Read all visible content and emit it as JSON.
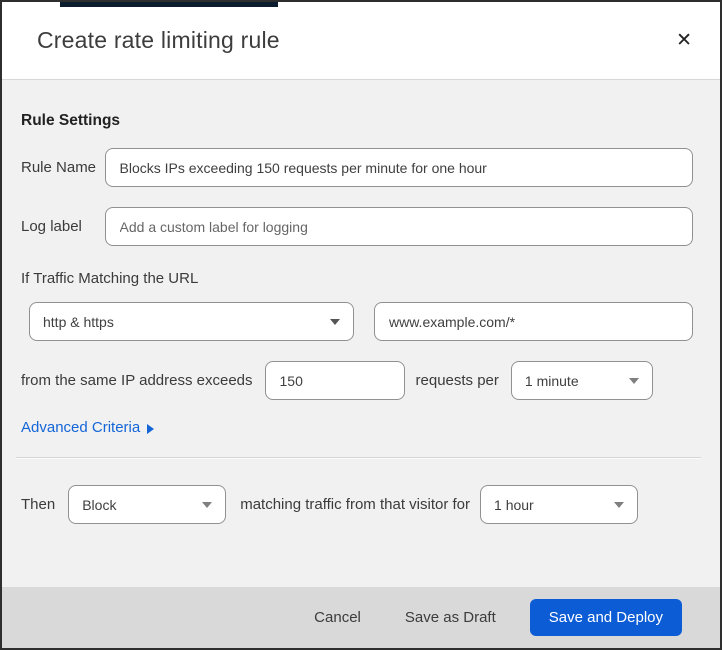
{
  "dialog": {
    "title": "Create rate limiting rule",
    "close_icon": "✕"
  },
  "rule_settings": {
    "section_heading": "Rule Settings",
    "rule_name": {
      "label": "Rule Name",
      "value": "Blocks IPs exceeding 150 requests per minute for one hour"
    },
    "log_label": {
      "label": "Log label",
      "placeholder": "Add a custom label for logging"
    }
  },
  "traffic_match": {
    "heading": "If Traffic Matching the URL",
    "scheme_select": {
      "selected": "http & https"
    },
    "url_input": {
      "value": "www.example.com/*"
    },
    "threshold": {
      "prefix": "from the same IP address exceeds",
      "requests_value": "150",
      "middle": "requests per",
      "period_selected": "1 minute"
    },
    "advanced_criteria": {
      "label": "Advanced Criteria"
    }
  },
  "action": {
    "prefix": "Then",
    "action_selected": "Block",
    "middle": "matching traffic from that visitor for",
    "duration_selected": "1 hour"
  },
  "footer": {
    "cancel_label": "Cancel",
    "save_draft_label": "Save as Draft",
    "save_deploy_label": "Save and Deploy"
  },
  "colors": {
    "primary_button": "#0b5cd5",
    "link": "#1465d8",
    "body_background": "#f1f1f1",
    "footer_background": "#d9d9d9",
    "dialog_border": "#2e2e2e",
    "top_strip": "#0b1c2e",
    "input_border": "#919191"
  }
}
